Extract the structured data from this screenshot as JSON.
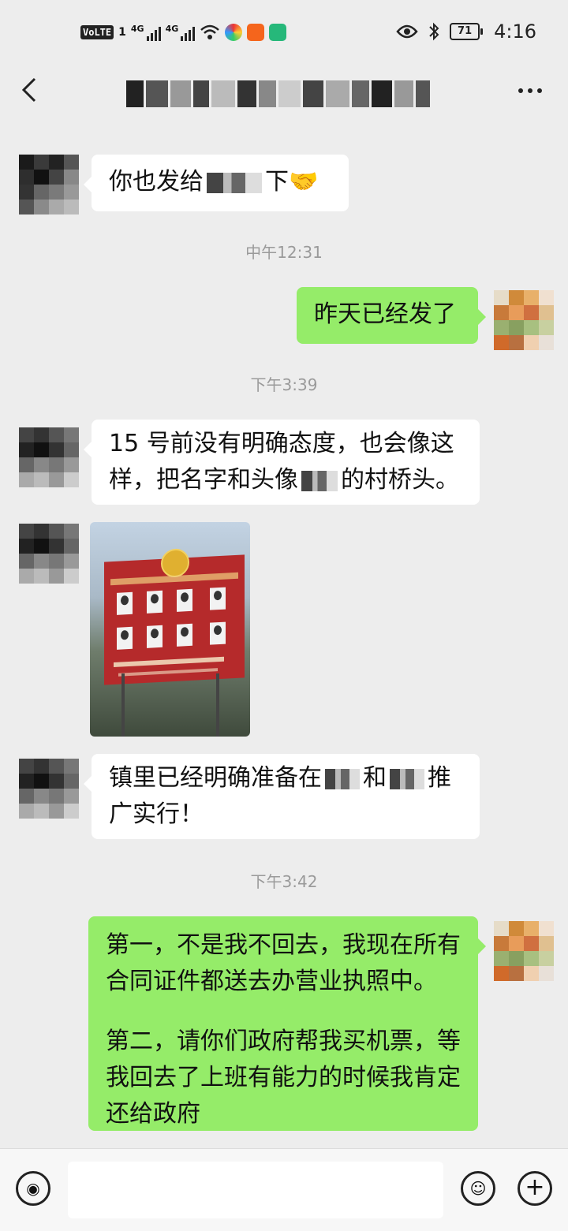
{
  "status_bar": {
    "volte": "VoLTE",
    "sim1": "1",
    "net1": "4G",
    "net2": "4G",
    "battery": "71",
    "time": "4:16"
  },
  "title_bar": {
    "back_icon": "chevron-left-icon",
    "more_icon": "more-dots-icon"
  },
  "messages": [
    {
      "side": "left",
      "text_a": "你也发给",
      "text_b": "下🤝"
    },
    {
      "type": "time",
      "text": "中午12:31"
    },
    {
      "side": "right",
      "text": "昨天已经发了"
    },
    {
      "type": "time",
      "text": "下午3:39"
    },
    {
      "side": "left",
      "line1": "15 号前没有明确态度，也会像这",
      "line2_a": "样，把名字和头像",
      "line2_b": "的村桥头。"
    },
    {
      "side": "left",
      "type": "image"
    },
    {
      "side": "left",
      "line1_a": "镇里已经明确准备在",
      "line1_b": "和",
      "line1_c": "推",
      "line2": "广实行！"
    },
    {
      "type": "time",
      "text": "下午3:42"
    },
    {
      "side": "right",
      "line1": "第一，不是我不回去，我现在所有",
      "line2": "合同证件都送去办营业执照中。",
      "line3": "第二，请你们政府帮我买机票，等",
      "line4": "我回去了上班有能力的时候我肯定",
      "line5": "还给政府"
    }
  ],
  "colors": {
    "my_bubble": "#95ec69",
    "other_bubble": "#ffffff",
    "background": "#ededed"
  }
}
